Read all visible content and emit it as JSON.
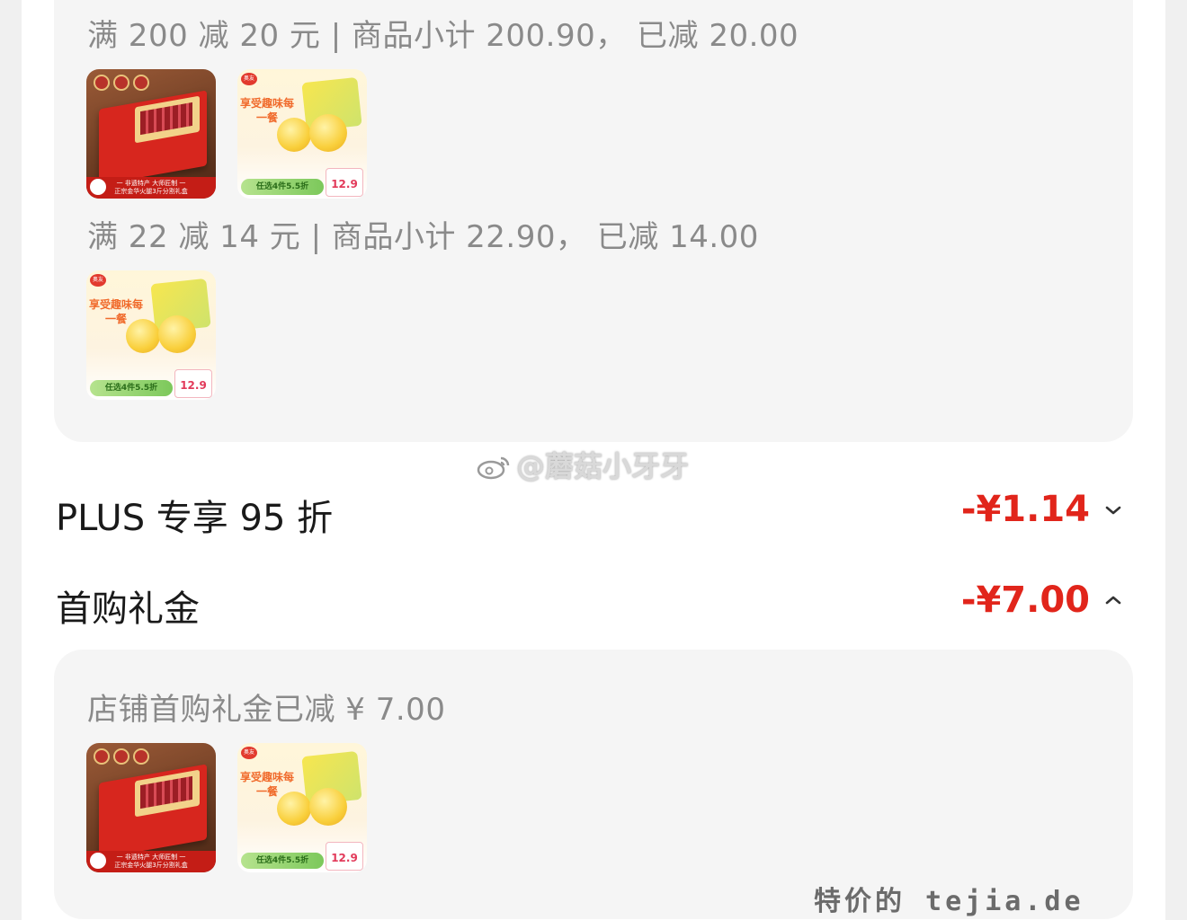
{
  "groups": [
    {
      "title": "满 200 减 20 元 | 商品小计 200.90， 已减 20.00",
      "products": [
        {
          "kind": "ham",
          "banner": "一 非遗特产 大师匠制 一\n正宗金华火腿3斤分割礼盒"
        },
        {
          "kind": "chick",
          "headline": "享受趣味每一餐",
          "pill": "任选4件5.5折",
          "price": "12.9",
          "logo": "奥友"
        }
      ]
    },
    {
      "title": "满 22 减 14 元 | 商品小计 22.90， 已减 14.00",
      "products": [
        {
          "kind": "chick",
          "headline": "享受趣味每一餐",
          "pill": "任选4件5.5折",
          "price": "12.9",
          "logo": "奥友"
        }
      ]
    }
  ],
  "discount_rows": [
    {
      "label": "PLUS 专享 95 折",
      "amount": "-¥1.14",
      "chevron": "chevron-down-icon"
    },
    {
      "label": "首购礼金",
      "amount": "-¥7.00",
      "chevron": "chevron-up-icon"
    }
  ],
  "first_purchase": {
    "title": "店铺首购礼金已减 ¥ 7.00",
    "products": [
      {
        "kind": "ham",
        "banner": "一 非遗特产 大师匠制 一\n正宗金华火腿3斤分割礼盒"
      },
      {
        "kind": "chick",
        "headline": "享受趣味每一餐",
        "pill": "任选4件5.5折",
        "price": "12.9",
        "logo": "奥友"
      }
    ]
  },
  "watermarks": {
    "weibo": "@蘑菇小牙牙",
    "site": "特价的 tejia.de"
  },
  "colors": {
    "accent_red": "#e1251b",
    "muted_text": "#8a8a8a",
    "panel_bg": "#f5f5f5"
  }
}
